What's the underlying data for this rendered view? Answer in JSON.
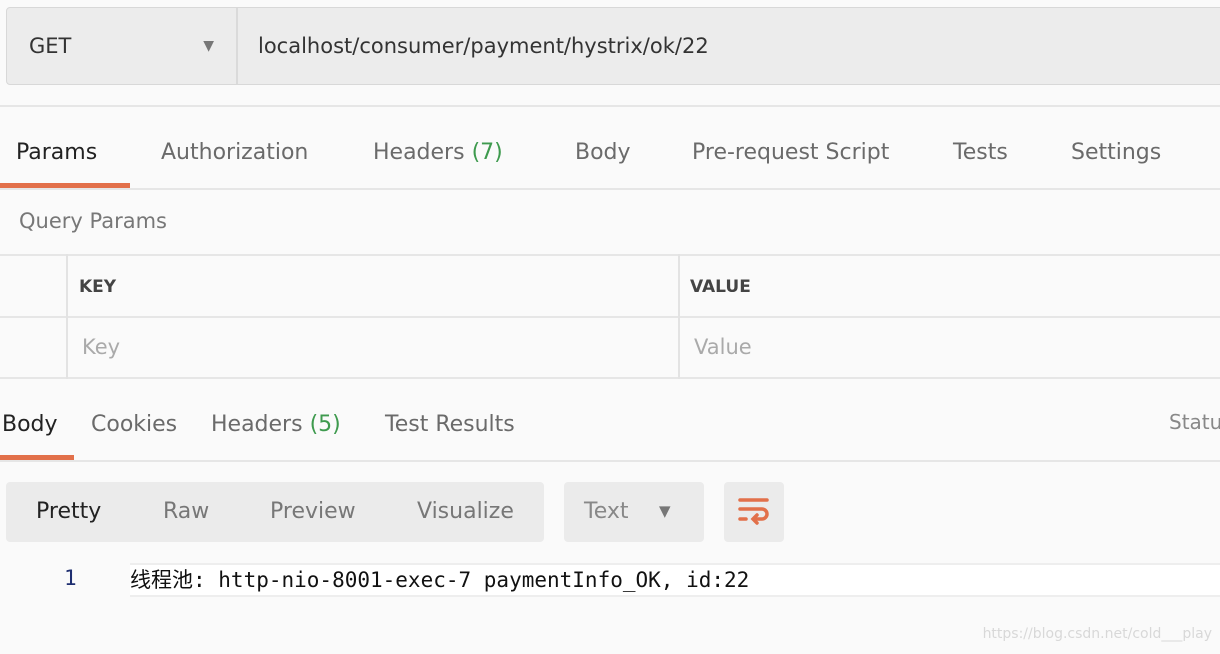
{
  "request": {
    "method": "GET",
    "url": "localhost/consumer/payment/hystrix/ok/22"
  },
  "request_tabs": [
    {
      "label": "Params"
    },
    {
      "label": "Authorization"
    },
    {
      "label": "Headers",
      "count": "(7)"
    },
    {
      "label": "Body"
    },
    {
      "label": "Pre-request Script"
    },
    {
      "label": "Tests"
    },
    {
      "label": "Settings"
    }
  ],
  "query_params": {
    "title": "Query Params",
    "key_header": "KEY",
    "value_header": "VALUE",
    "key_placeholder": "Key",
    "value_placeholder": "Value"
  },
  "response_tabs": [
    {
      "label": "Body"
    },
    {
      "label": "Cookies"
    },
    {
      "label": "Headers",
      "count": "(5)"
    },
    {
      "label": "Test Results"
    }
  ],
  "status_label": "Statu",
  "view_modes": [
    "Pretty",
    "Raw",
    "Preview",
    "Visualize"
  ],
  "format": "Text",
  "wrap_icon": "wrap-lines-icon",
  "code": {
    "line_number": "1",
    "text": "线程池: http-nio-8001-exec-7 paymentInfo_OK, id:22"
  },
  "watermark": "https://blog.csdn.net/cold___play",
  "colors": {
    "accent": "#e2704a",
    "count": "#3e9a4e"
  }
}
